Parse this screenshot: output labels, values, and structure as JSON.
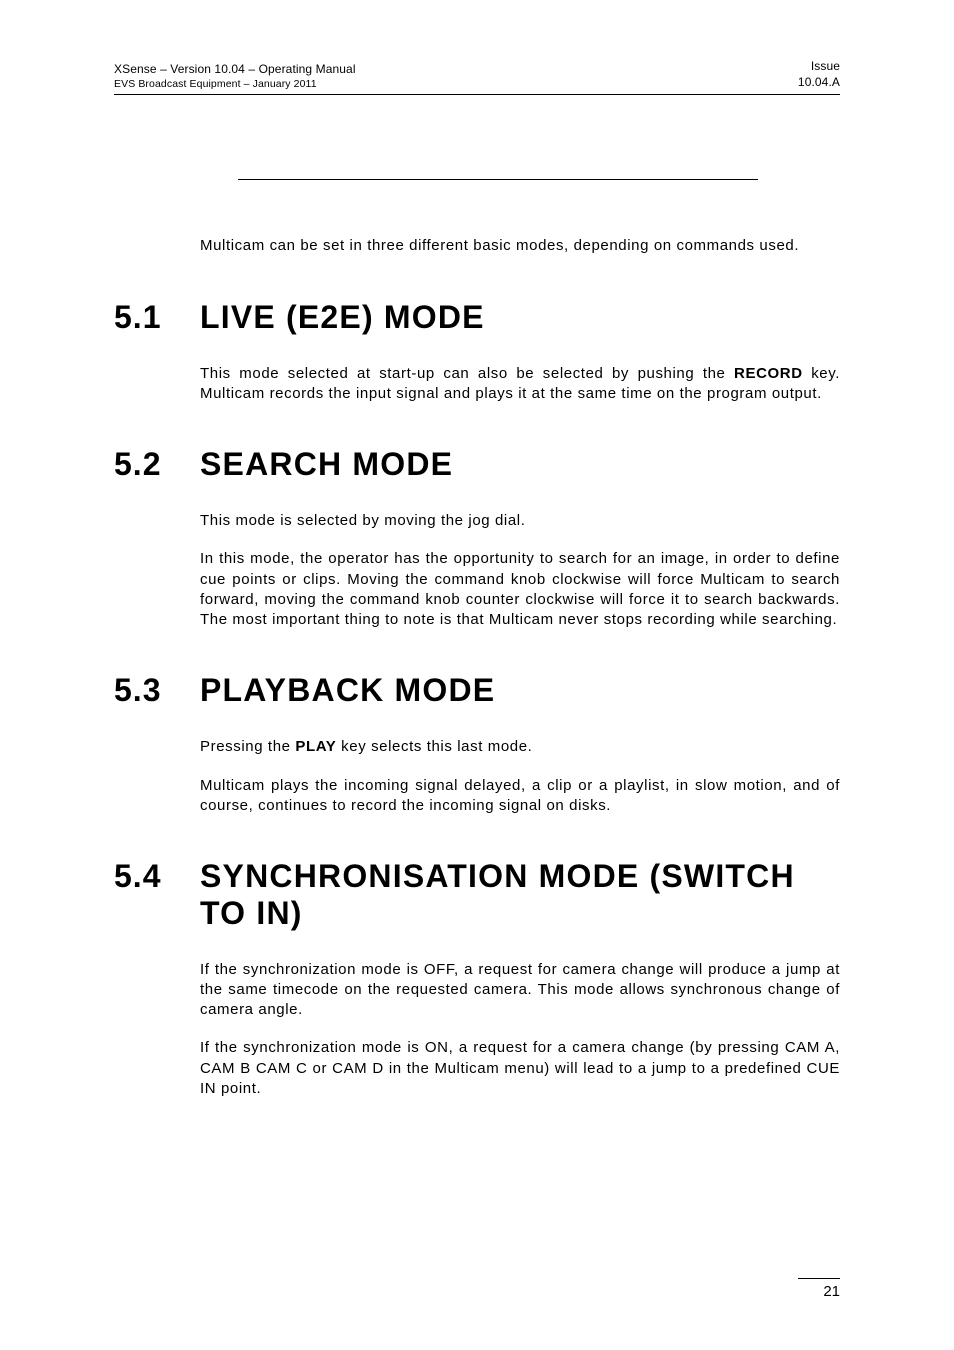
{
  "header": {
    "left_top": "XSense – Version 10.04 – Operating Manual",
    "left_bottom": "EVS Broadcast Equipment  – January 2011",
    "right_top": "Issue",
    "right_bottom": "10.04.A"
  },
  "intro": "Multicam can be set in three different basic modes, depending on commands used.",
  "sections": [
    {
      "num": "5.1",
      "title": "LIVE (E2E) MODE",
      "paras": [
        {
          "pre": "This mode selected at start-up can also be selected by pushing the ",
          "bold": "RECORD",
          "post": " key. Multicam records the input signal and plays it at the same time on the program output."
        }
      ]
    },
    {
      "num": "5.2",
      "title": "SEARCH MODE",
      "paras": [
        {
          "plain": "This mode is selected by moving the jog dial."
        },
        {
          "plain": "In this mode, the operator has the opportunity to search for an image, in order to define cue points or clips. Moving the command knob clockwise will force Multicam to search forward, moving the command knob counter clockwise will force it to search backwards. The most important thing to note is that Multicam never stops recording while searching."
        }
      ]
    },
    {
      "num": "5.3",
      "title": "PLAYBACK MODE",
      "paras": [
        {
          "pre": "Pressing the ",
          "bold": "PLAY",
          "post": " key selects this last mode."
        },
        {
          "plain": "Multicam plays the incoming signal delayed, a clip or a playlist, in slow motion, and of course, continues to record the incoming signal on disks."
        }
      ]
    },
    {
      "num": "5.4",
      "title": "SYNCHRONISATION MODE (SWITCH TO IN)",
      "paras": [
        {
          "plain": "If the synchronization mode is OFF, a request for camera change will produce a jump at the same timecode on the requested camera. This mode allows synchronous change of camera angle."
        },
        {
          "plain": "If the synchronization mode is ON, a request for a camera change (by pressing CAM A, CAM B CAM C or CAM D in the Multicam menu) will lead to a jump to a predefined CUE IN point."
        }
      ]
    }
  ],
  "footer": {
    "page_number": "21"
  }
}
